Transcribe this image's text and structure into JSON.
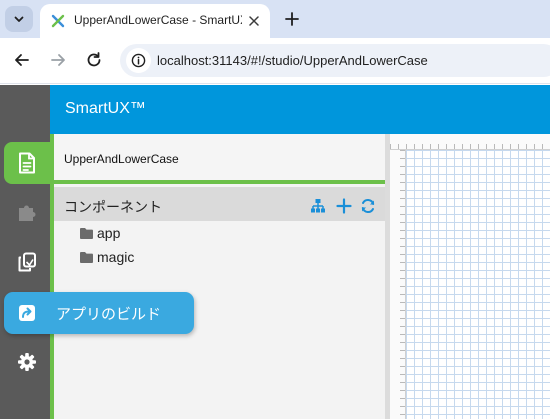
{
  "browser": {
    "tab": {
      "title": "UpperAndLowerCase - SmartUX"
    },
    "url": "localhost:31143/#!/studio/UpperAndLowerCase"
  },
  "app": {
    "brand": "SmartUX™",
    "project_name": "UpperAndLowerCase",
    "components": {
      "title": "コンポーネント",
      "items": [
        {
          "label": "app"
        },
        {
          "label": "magic"
        }
      ]
    },
    "rail": {
      "items": [
        {
          "icon": "document-icon",
          "active": true
        },
        {
          "icon": "puzzle-icon",
          "active": false
        },
        {
          "icon": "copy-icon",
          "active": false
        },
        {
          "icon": "build-icon",
          "active": false
        },
        {
          "icon": "gear-icon",
          "active": false
        }
      ],
      "hover_label": "アプリのビルド"
    },
    "colors": {
      "header": "#0096dc",
      "accent_green": "#6cc04a",
      "rail": "#5a5a5a",
      "tooltip": "#3aa9e0",
      "action_icon": "#1a8fd8"
    }
  }
}
